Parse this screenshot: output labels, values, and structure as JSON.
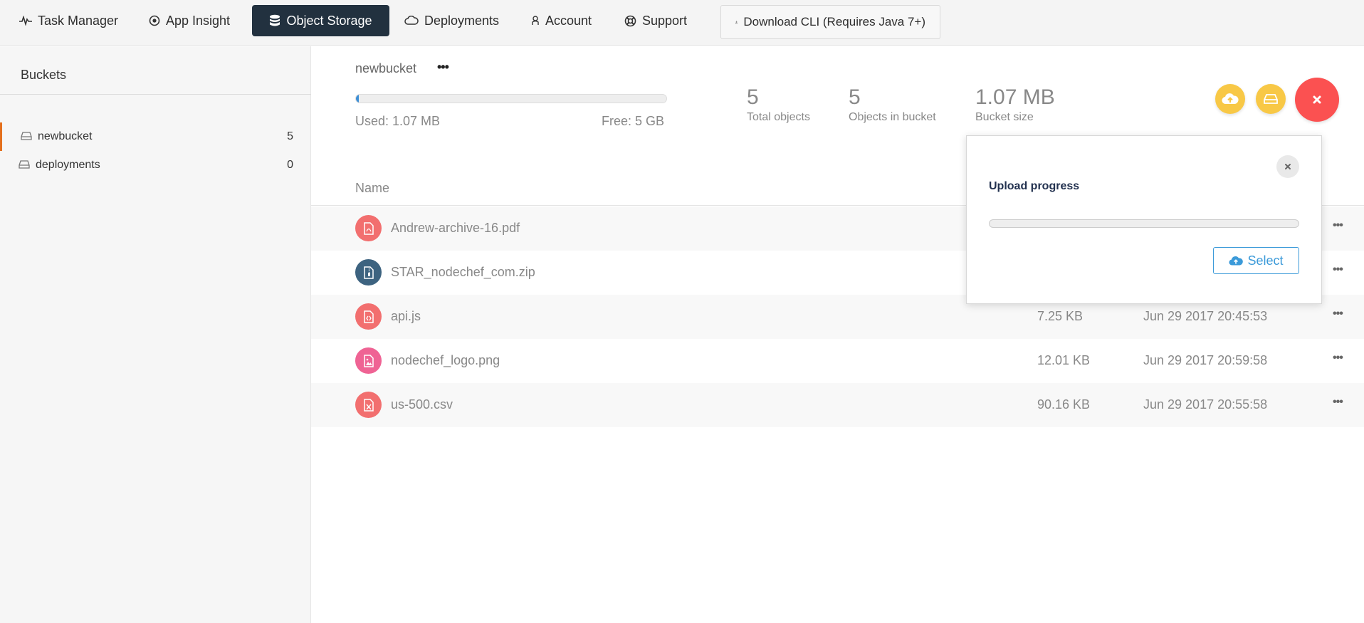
{
  "nav": {
    "items": [
      {
        "label": "Task Manager",
        "icon": "pulse-icon"
      },
      {
        "label": "App Insight",
        "icon": "target-icon"
      },
      {
        "label": "Object Storage",
        "icon": "database-icon",
        "active": true
      },
      {
        "label": "Deployments",
        "icon": "cloud-icon"
      },
      {
        "label": "Account",
        "icon": "user-icon"
      },
      {
        "label": "Support",
        "icon": "lifebuoy-icon"
      }
    ],
    "cli_label": "Download CLI (Requires Java 7+)"
  },
  "sidebar": {
    "title": "Buckets",
    "buckets": [
      {
        "name": "newbucket",
        "count": "5",
        "active": true
      },
      {
        "name": "deployments",
        "count": "0",
        "active": false
      }
    ]
  },
  "bucket": {
    "name": "newbucket",
    "more": "•••",
    "used": "Used: 1.07 MB",
    "free": "Free: 5 GB",
    "usage_fraction": 0.002
  },
  "stats": [
    {
      "value": "5",
      "label": "Total objects"
    },
    {
      "value": "5",
      "label": "Objects in bucket"
    },
    {
      "value": "1.07 MB",
      "label": "Bucket size"
    }
  ],
  "table": {
    "header_name": "Name",
    "more": "•••",
    "rows": [
      {
        "name": "Andrew-archive-16.pdf",
        "size": "",
        "date": "",
        "icon": "pdf-file-icon",
        "color": "#f26f6f"
      },
      {
        "name": "STAR_nodechef_com.zip",
        "size": "",
        "date": "",
        "icon": "zip-file-icon",
        "color": "#3d6380"
      },
      {
        "name": "api.js",
        "size": "7.25 KB",
        "date": "Jun 29 2017 20:45:53",
        "icon": "code-file-icon",
        "color": "#f26f6f"
      },
      {
        "name": "nodechef_logo.png",
        "size": "12.01 KB",
        "date": "Jun 29 2017 20:59:58",
        "icon": "image-file-icon",
        "color": "#ef6394"
      },
      {
        "name": "us-500.csv",
        "size": "90.16 KB",
        "date": "Jun 29 2017 20:55:58",
        "icon": "excel-file-icon",
        "color": "#f26f6f"
      }
    ]
  },
  "upload": {
    "title": "Upload progress",
    "select_label": "Select",
    "progress_fraction": 0
  },
  "colors": {
    "active_nav": "#22313f",
    "accent_orange": "#e4701e",
    "fab_yellow": "#f8c846",
    "fab_red": "#fb5151",
    "link_blue": "#3b9ad9"
  }
}
